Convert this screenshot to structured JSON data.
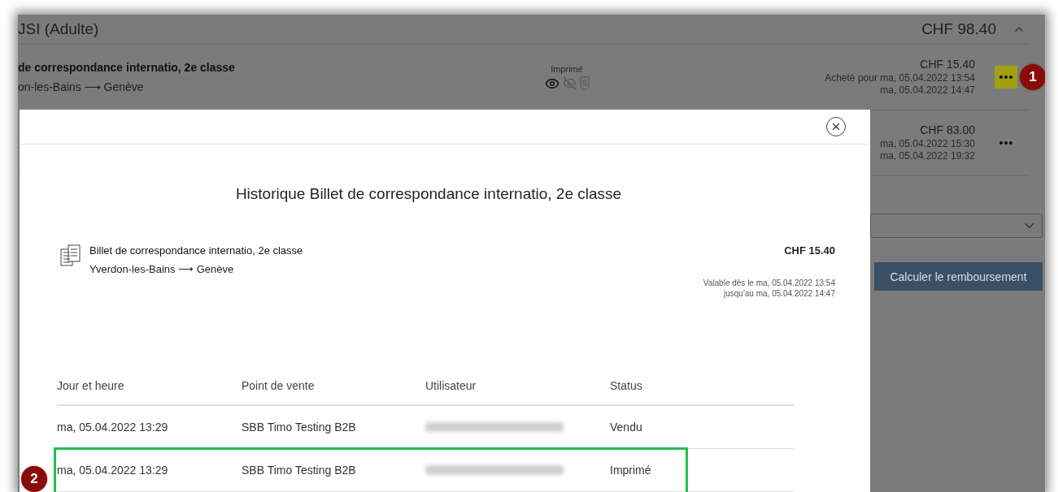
{
  "background": {
    "group": {
      "title": "JSI (Adulte)",
      "total": "CHF 98.40",
      "expanded": true
    },
    "tickets": [
      {
        "title": "de correspondance internatio, 2e classe",
        "route": "on-les-Bains ⟶ Genève",
        "status": "Imprimé",
        "price": "CHF 15.40",
        "lines": [
          "Acheté pour ma, 05.04.2022 13:54",
          "ma, 05.04.2022 14:47"
        ],
        "highlighted": true
      },
      {
        "price": "CHF 83.00",
        "lines": [
          "ma, 05.04.2022 15:30",
          "ma, 05.04.2022 19:32"
        ],
        "highlighted": false
      }
    ],
    "refund_button": "Calculer le remboursement"
  },
  "modal": {
    "title": "Historique Billet de correspondance internatio, 2e classe",
    "ticket": {
      "title": "Billet de correspondance internatio, 2e classe",
      "route": "Yverdon-les-Bains ⟶ Genève",
      "price": "CHF 15.40",
      "validity": [
        "Valable dès le ma, 05.04.2022 13:54",
        "jusqu'au ma, 05.04.2022 14:47"
      ]
    },
    "columns": [
      "Jour et heure",
      "Point de vente",
      "Utilisateur",
      "Status"
    ],
    "rows": [
      {
        "date": "ma, 05.04.2022 13:29",
        "point": "SBB Timo Testing B2B",
        "status": "Vendu",
        "highlighted": false
      },
      {
        "date": "ma, 05.04.2022 13:29",
        "point": "SBB Timo Testing B2B",
        "status": "Imprimé",
        "highlighted": true
      }
    ]
  },
  "annotations": [
    "1",
    "2"
  ]
}
